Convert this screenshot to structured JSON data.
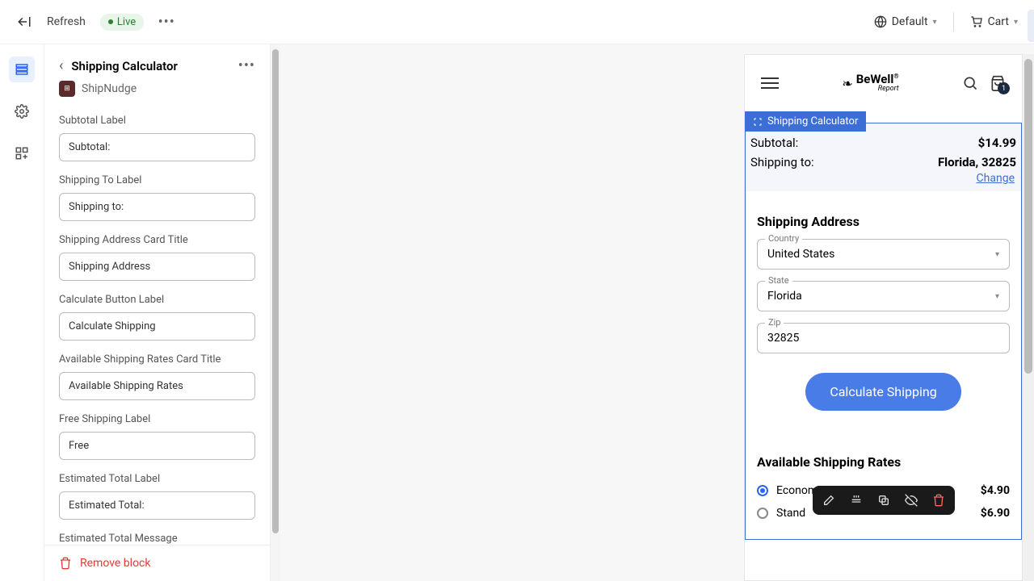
{
  "topbar": {
    "refresh": "Refresh",
    "live": "Live",
    "default": "Default",
    "cart": "Cart"
  },
  "panel": {
    "title": "Shipping Calculator",
    "brand": "ShipNudge",
    "remove": "Remove block",
    "fields": {
      "subtotal": {
        "label": "Subtotal Label",
        "value": "Subtotal:"
      },
      "shipto": {
        "label": "Shipping To Label",
        "value": "Shipping to:"
      },
      "addrtitle": {
        "label": "Shipping Address Card Title",
        "value": "Shipping Address"
      },
      "calcbtn": {
        "label": "Calculate Button Label",
        "value": "Calculate Shipping"
      },
      "ratestitle": {
        "label": "Available Shipping Rates Card Title",
        "value": "Available Shipping Rates"
      },
      "freelabel": {
        "label": "Free Shipping Label",
        "value": "Free"
      },
      "esttotal": {
        "label": "Estimated Total Label",
        "value": "Estimated Total:"
      },
      "estmsg": {
        "label": "Estimated Total Message"
      }
    }
  },
  "preview": {
    "logo_name": "BeWell",
    "logo_sub": "Report",
    "bag_count": "1",
    "calc_tag": "Shipping Calculator",
    "subtotal_label": "Subtotal:",
    "subtotal_value": "$14.99",
    "shipto_label": "Shipping to:",
    "shipto_value": "Florida, 32825",
    "change": "Change",
    "addr_title": "Shipping Address",
    "country_label": "Country",
    "country_value": "United States",
    "state_label": "State",
    "state_value": "Florida",
    "zip_label": "Zip",
    "zip_value": "32825",
    "calc_button": "Calculate Shipping",
    "rates_title": "Available Shipping Rates",
    "rates": [
      {
        "name": "Economy",
        "price": "$4.90",
        "checked": true
      },
      {
        "name": "Stand",
        "price": "$6.90",
        "checked": false
      }
    ]
  }
}
